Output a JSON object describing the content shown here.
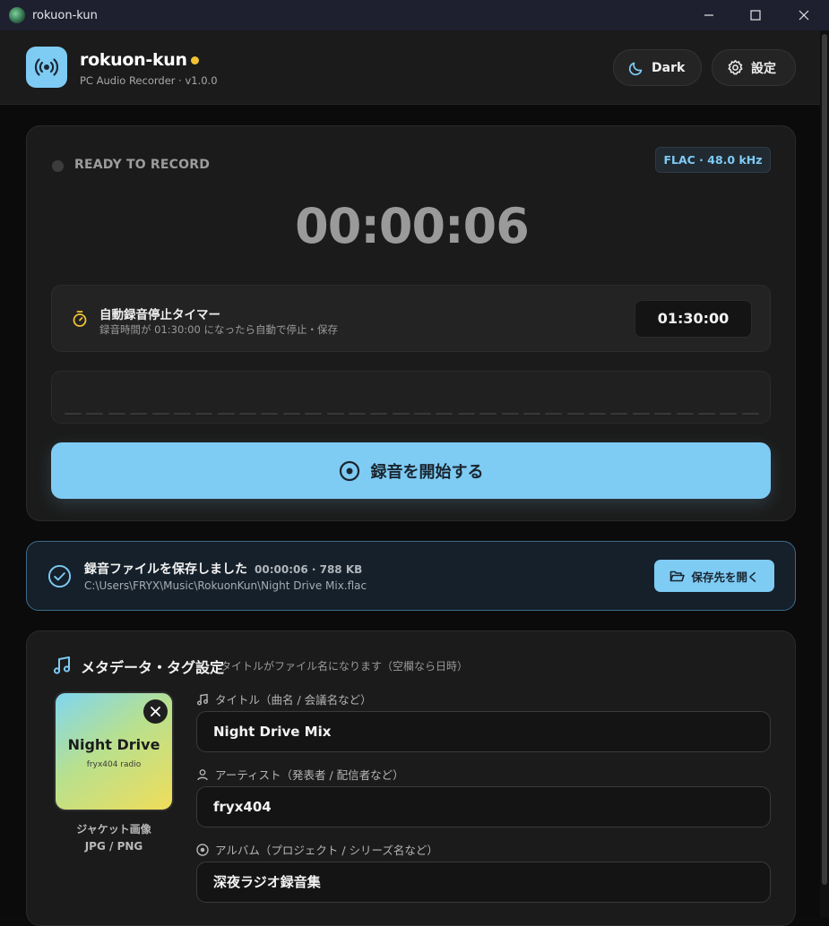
{
  "window": {
    "title": "rokuon-kun"
  },
  "header": {
    "app_name": "rokuon-kun",
    "subtitle": "PC Audio Recorder · v1.0.0",
    "theme_label": "Dark",
    "settings_label": "設定"
  },
  "recorder": {
    "status": "READY TO RECORD",
    "format": "FLAC · 48.0 kHz",
    "elapsed": "00:00:06",
    "auto_timer": {
      "label": "自動録音停止タイマー",
      "description": "録音時間が 01:30:00 になったら自動で停止・保存",
      "value": "01:30:00"
    },
    "record_button": "録音を開始する"
  },
  "saved": {
    "title": "録音ファイルを保存しました",
    "meta": "00:00:06 · 788 KB",
    "path": "C:\\Users\\FRYX\\Music\\RokuonKun\\Night Drive Mix.flac",
    "open_button": "保存先を開く"
  },
  "metadata": {
    "title": "メタデータ・タグ設定",
    "hint": "タイトルがファイル名になります（空欄なら日時）",
    "jacket": {
      "art_title": "Night Drive",
      "art_subtitle": "fryx404 radio",
      "label": "ジャケット画像",
      "formats": "JPG / PNG"
    },
    "fields": [
      {
        "label": "タイトル（曲名 / 会議名など）",
        "value": "Night Drive Mix",
        "icon": "music-note-icon"
      },
      {
        "label": "アーティスト（発表者 / 配信者など）",
        "value": "fryx404",
        "icon": "user-icon"
      },
      {
        "label": "アルバム（プロジェクト / シリーズ名など）",
        "value": "深夜ラジオ録音集",
        "icon": "disc-icon"
      }
    ]
  },
  "colors": {
    "accent": "#7ecbf4",
    "dot": "#f2c233",
    "timer_icon": "#f2c233"
  }
}
